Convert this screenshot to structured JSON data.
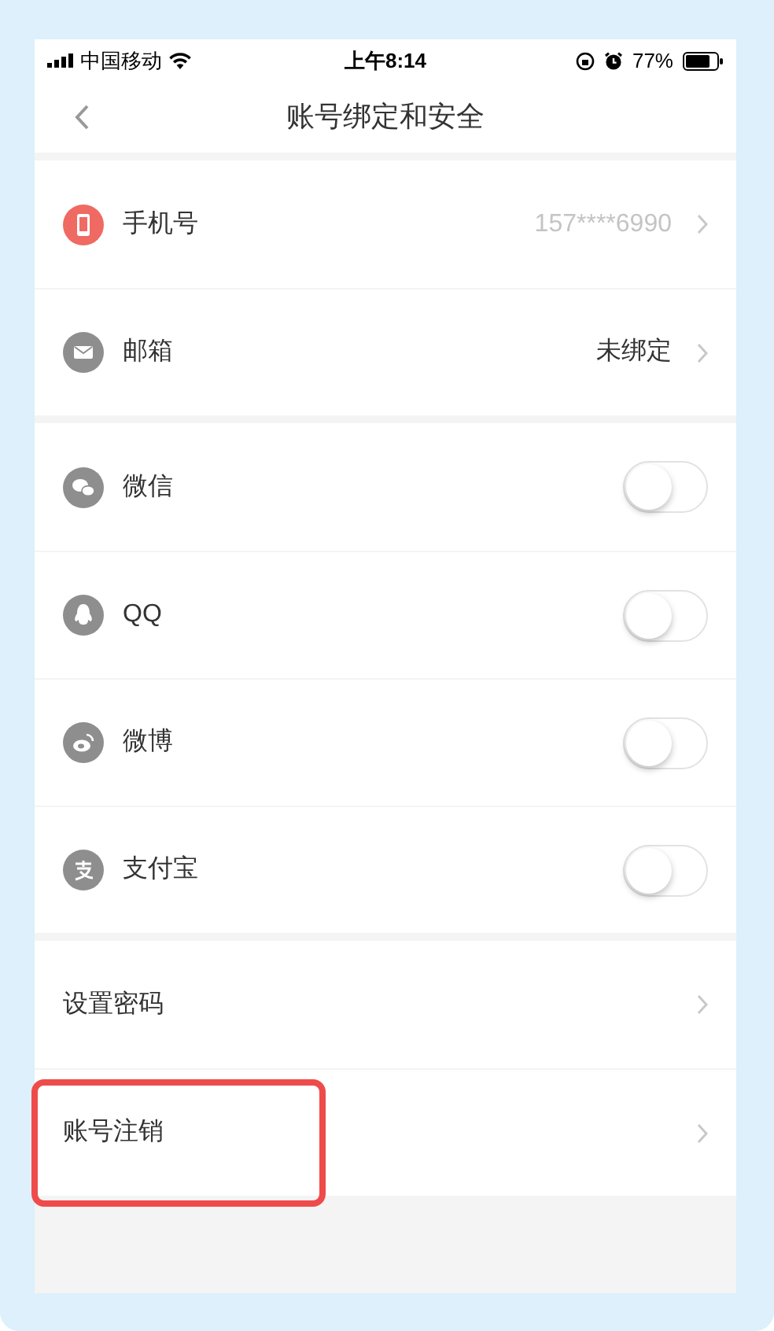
{
  "status_bar": {
    "carrier": "中国移动",
    "time": "上午8:14",
    "battery": "77%"
  },
  "nav": {
    "title": "账号绑定和安全"
  },
  "sections": [
    {
      "items": [
        {
          "kind": "link",
          "color": "#ef6a62",
          "label": "手机号",
          "value": "157****6990",
          "value_muted": true,
          "highlighted": false
        },
        {
          "kind": "link",
          "color": "#8e8e8e",
          "label": "邮箱",
          "value": "未绑定",
          "value_muted": false,
          "highlighted": false
        }
      ]
    },
    {
      "items": [
        {
          "kind": "toggle",
          "color": "#8e8e8e",
          "label": "微信",
          "on": false,
          "highlighted": false
        },
        {
          "kind": "toggle",
          "color": "#8e8e8e",
          "label": "QQ",
          "on": false,
          "highlighted": false
        },
        {
          "kind": "toggle",
          "color": "#8e8e8e",
          "label": "微博",
          "on": false,
          "highlighted": false
        },
        {
          "kind": "toggle",
          "color": "#8e8e8e",
          "label": "支付宝",
          "on": false,
          "highlighted": false
        }
      ]
    },
    {
      "items": [
        {
          "kind": "link",
          "label": "设置密码",
          "highlighted": false
        },
        {
          "kind": "link",
          "label": "账号注销",
          "highlighted": true
        }
      ]
    }
  ]
}
